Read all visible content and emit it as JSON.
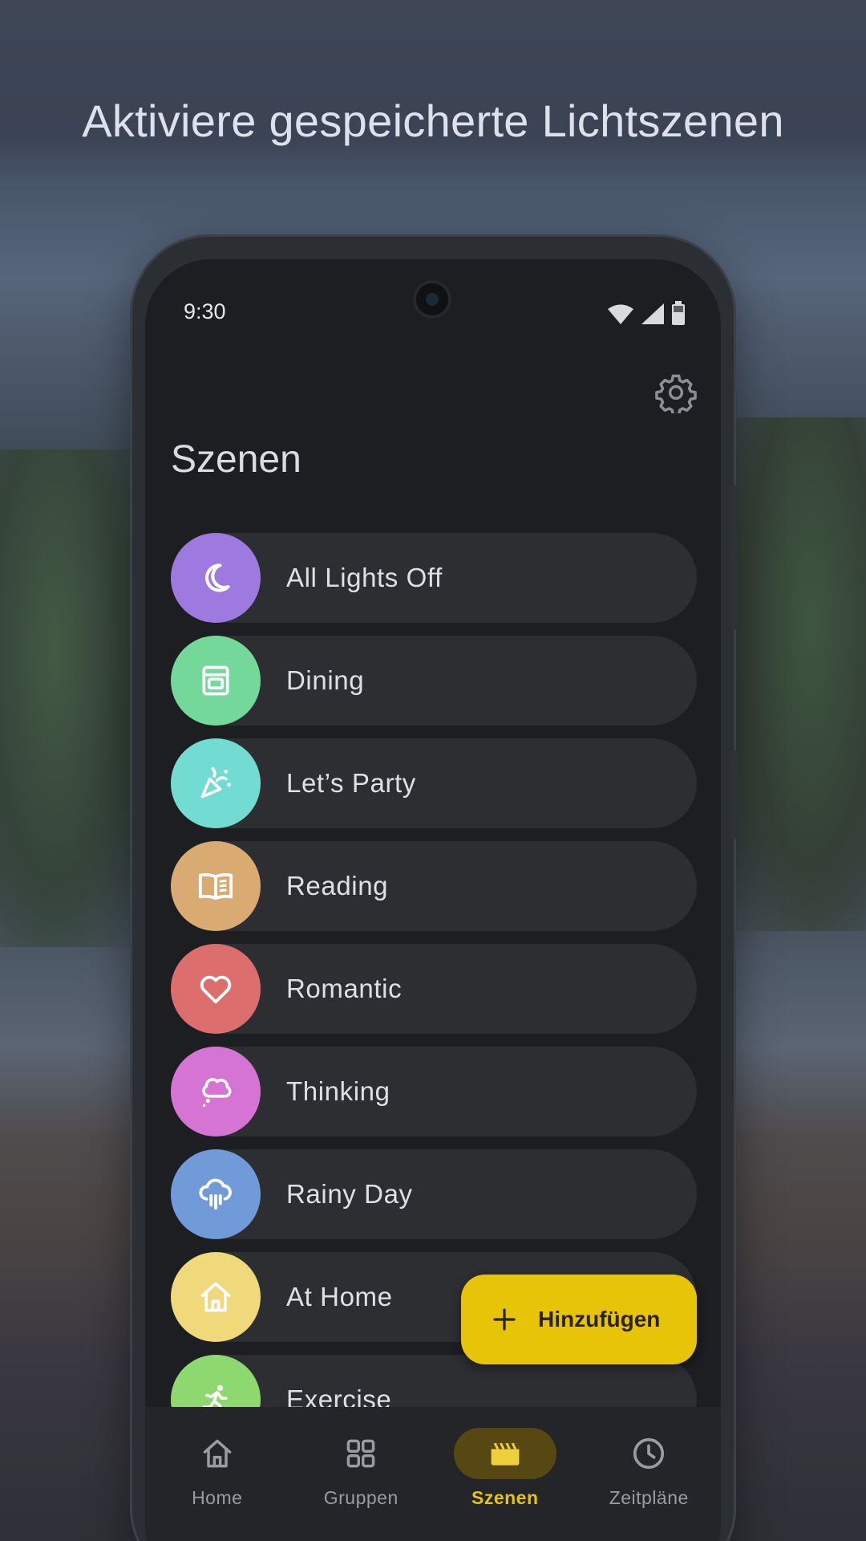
{
  "headline": "Aktiviere gespeicherte Lichtszenen",
  "status": {
    "time": "9:30"
  },
  "screen": {
    "title": "Szenen"
  },
  "scenes": [
    {
      "label": "All Lights Off",
      "icon": "moon-icon",
      "color": "#9e7ae0"
    },
    {
      "label": "Dining",
      "icon": "oven-icon",
      "color": "#73d89a"
    },
    {
      "label": "Let’s Party",
      "icon": "party-popper-icon",
      "color": "#73dcd2"
    },
    {
      "label": "Reading",
      "icon": "book-open-icon",
      "color": "#d9aa72"
    },
    {
      "label": "Romantic",
      "icon": "heart-icon",
      "color": "#dc6e6e"
    },
    {
      "label": "Thinking",
      "icon": "thought-bubble-icon",
      "color": "#d674d4"
    },
    {
      "label": "Rainy Day",
      "icon": "rain-cloud-icon",
      "color": "#719ad8"
    },
    {
      "label": "At Home",
      "icon": "house-icon",
      "color": "#f0d97a"
    },
    {
      "label": "Exercise",
      "icon": "running-icon",
      "color": "#8ed870"
    }
  ],
  "fab": {
    "label": "Hinzufügen",
    "color": "#e8c408"
  },
  "nav": [
    {
      "label": "Home",
      "icon": "home-icon"
    },
    {
      "label": "Gruppen",
      "icon": "grid-icon"
    },
    {
      "label": "Szenen",
      "icon": "clapperboard-icon",
      "active": true
    },
    {
      "label": "Zeitpläne",
      "icon": "clock-icon"
    }
  ],
  "colors": {
    "accent": "#e8c408",
    "surface": "#1d1e21",
    "card": "#2d2e32"
  }
}
